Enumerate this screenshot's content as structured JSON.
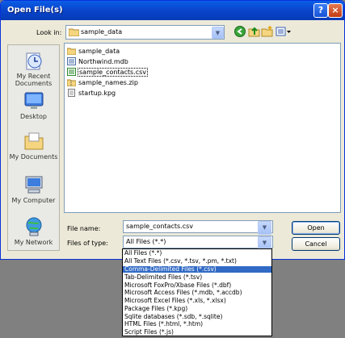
{
  "window": {
    "title": "Open File(s)",
    "help_icon": "?",
    "close_icon": "×"
  },
  "toolbar": {
    "look_in_label": "Look in:",
    "look_in_value": "sample_data"
  },
  "places": [
    {
      "label": "My Recent Documents",
      "icon": "recent-documents-icon"
    },
    {
      "label": "Desktop",
      "icon": "desktop-icon"
    },
    {
      "label": "My Documents",
      "icon": "my-documents-icon"
    },
    {
      "label": "My Computer",
      "icon": "my-computer-icon"
    },
    {
      "label": "My Network",
      "icon": "my-network-icon"
    }
  ],
  "files": [
    {
      "name": "sample_data",
      "icon": "folder-icon"
    },
    {
      "name": "Northwind.mdb",
      "icon": "database-file-icon"
    },
    {
      "name": "sample_contacts.csv",
      "icon": "csv-file-icon",
      "selected": true
    },
    {
      "name": "sample_names.zip",
      "icon": "zip-file-icon"
    },
    {
      "name": "startup.kpg",
      "icon": "document-file-icon"
    }
  ],
  "file_name": {
    "label": "File name:",
    "value": "sample_contacts.csv"
  },
  "file_type": {
    "label": "Files of type:",
    "value": "All Files (*.*)",
    "options": [
      "All Files (*.*)",
      "All Text Files (*.csv, *.tsv, *.pm, *.txt)",
      "Comma-Delimited Files (*.csv)",
      "Tab-Delimited Files (*.tsv)",
      "Microsoft FoxPro/Xbase Files (*.dbf)",
      "Microsoft Access Files (*.mdb, *.accdb)",
      "Microsoft Excel Files (*.xls, *.xlsx)",
      "Package Files (*.kpg)",
      "Sqlite databases (*.sdb, *.sqlite)",
      "HTML Files (*.html, *.htm)",
      "Script Files (*.js)"
    ],
    "highlighted_option": "Comma-Delimited Files (*.csv)"
  },
  "buttons": {
    "open": "Open",
    "cancel": "Cancel"
  }
}
